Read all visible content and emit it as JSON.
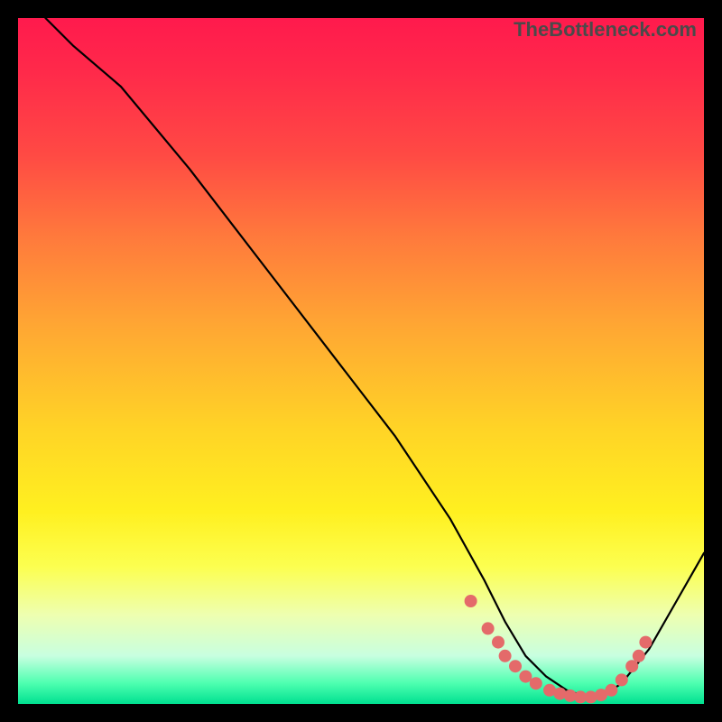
{
  "attribution": "TheBottleneck.com",
  "chart_data": {
    "type": "line",
    "title": "",
    "xlabel": "",
    "ylabel": "",
    "xlim": [
      0,
      100
    ],
    "ylim": [
      0,
      100
    ],
    "series": [
      {
        "name": "curve",
        "x": [
          4,
          8,
          15,
          25,
          35,
          45,
          55,
          63,
          68,
          71,
          74,
          77,
          80,
          83,
          85,
          88,
          92,
          96,
          100
        ],
        "y": [
          100,
          96,
          90,
          78,
          65,
          52,
          39,
          27,
          18,
          12,
          7,
          4,
          2,
          1,
          1,
          3,
          8,
          15,
          22
        ]
      }
    ],
    "points": [
      {
        "x": 66,
        "y": 15
      },
      {
        "x": 68.5,
        "y": 11
      },
      {
        "x": 70,
        "y": 9
      },
      {
        "x": 71,
        "y": 7
      },
      {
        "x": 72.5,
        "y": 5.5
      },
      {
        "x": 74,
        "y": 4
      },
      {
        "x": 75.5,
        "y": 3
      },
      {
        "x": 77.5,
        "y": 2
      },
      {
        "x": 79,
        "y": 1.5
      },
      {
        "x": 80.5,
        "y": 1.2
      },
      {
        "x": 82,
        "y": 1
      },
      {
        "x": 83.5,
        "y": 1
      },
      {
        "x": 85,
        "y": 1.3
      },
      {
        "x": 86.5,
        "y": 2
      },
      {
        "x": 88,
        "y": 3.5
      },
      {
        "x": 89.5,
        "y": 5.5
      },
      {
        "x": 90.5,
        "y": 7
      },
      {
        "x": 91.5,
        "y": 9
      }
    ],
    "gradient_stops": [
      {
        "pos": 0,
        "color": "#ff1a4d"
      },
      {
        "pos": 50,
        "color": "#ffd426"
      },
      {
        "pos": 100,
        "color": "#00e090"
      }
    ]
  }
}
